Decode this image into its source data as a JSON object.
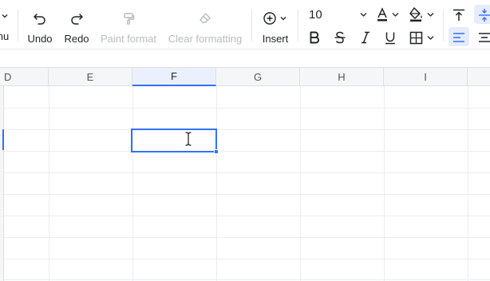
{
  "toolbar": {
    "partial_menu_label": "nu",
    "undo_label": "Undo",
    "redo_label": "Redo",
    "paint_format_label": "Paint format",
    "clear_formatting_label": "Clear formatting",
    "insert_label": "Insert",
    "font_size_value": "10",
    "icons": [
      "undo-icon",
      "redo-icon",
      "paint-format-icon",
      "clear-formatting-icon",
      "insert-plus-icon",
      "font-color-icon",
      "fill-color-icon",
      "align-top-icon",
      "align-middle-icon",
      "bold-icon",
      "strikethrough-icon",
      "italic-icon",
      "underline-icon",
      "borders-icon",
      "align-left-icon",
      "align-center-icon"
    ]
  },
  "sheet": {
    "columns": [
      "D",
      "E",
      "F",
      "G",
      "H",
      "I"
    ],
    "active_column": "F"
  },
  "colors": {
    "accent": "#3370ff",
    "disabled_text": "#b8bcc2",
    "header_bg": "#f5f6f7",
    "active_header_bg": "#eaf0fd"
  }
}
